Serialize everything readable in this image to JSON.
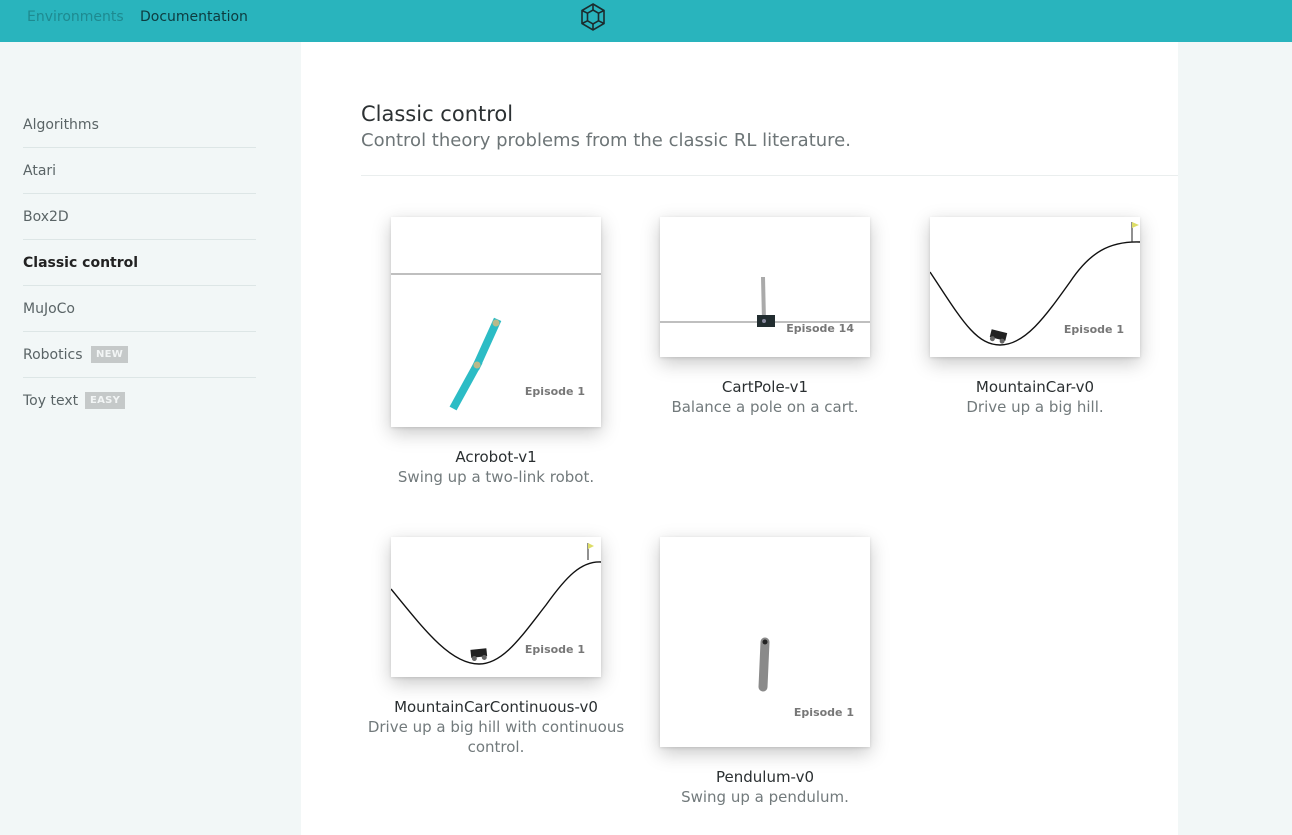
{
  "topnav": {
    "environments_label": "Environments",
    "documentation_label": "Documentation",
    "logo_icon": "openai-logo-icon",
    "bar_color": "#29b4bd"
  },
  "sidebar": {
    "items": [
      {
        "label": "Algorithms"
      },
      {
        "label": "Atari"
      },
      {
        "label": "Box2D"
      },
      {
        "label": "Classic control",
        "active": true
      },
      {
        "label": "MuJoCo"
      },
      {
        "label": "Robotics",
        "badge": "NEW"
      },
      {
        "label": "Toy text",
        "badge": "EASY"
      }
    ]
  },
  "section": {
    "title": "Classic control",
    "subtitle": "Control theory problems from the classic RL literature."
  },
  "environments": [
    {
      "name": "Acrobot-v1",
      "desc": "Swing up a two-link robot.",
      "episode": "Episode 1"
    },
    {
      "name": "CartPole-v1",
      "desc": "Balance a pole on a cart.",
      "episode": "Episode 14"
    },
    {
      "name": "MountainCar-v0",
      "desc": "Drive up a big hill.",
      "episode": "Episode 1"
    },
    {
      "name": "MountainCarContinuous-v0",
      "desc": "Drive up a big hill with continuous control.",
      "episode": "Episode 1"
    },
    {
      "name": "Pendulum-v0",
      "desc": "Swing up a pendulum.",
      "episode": "Episode 1"
    }
  ]
}
